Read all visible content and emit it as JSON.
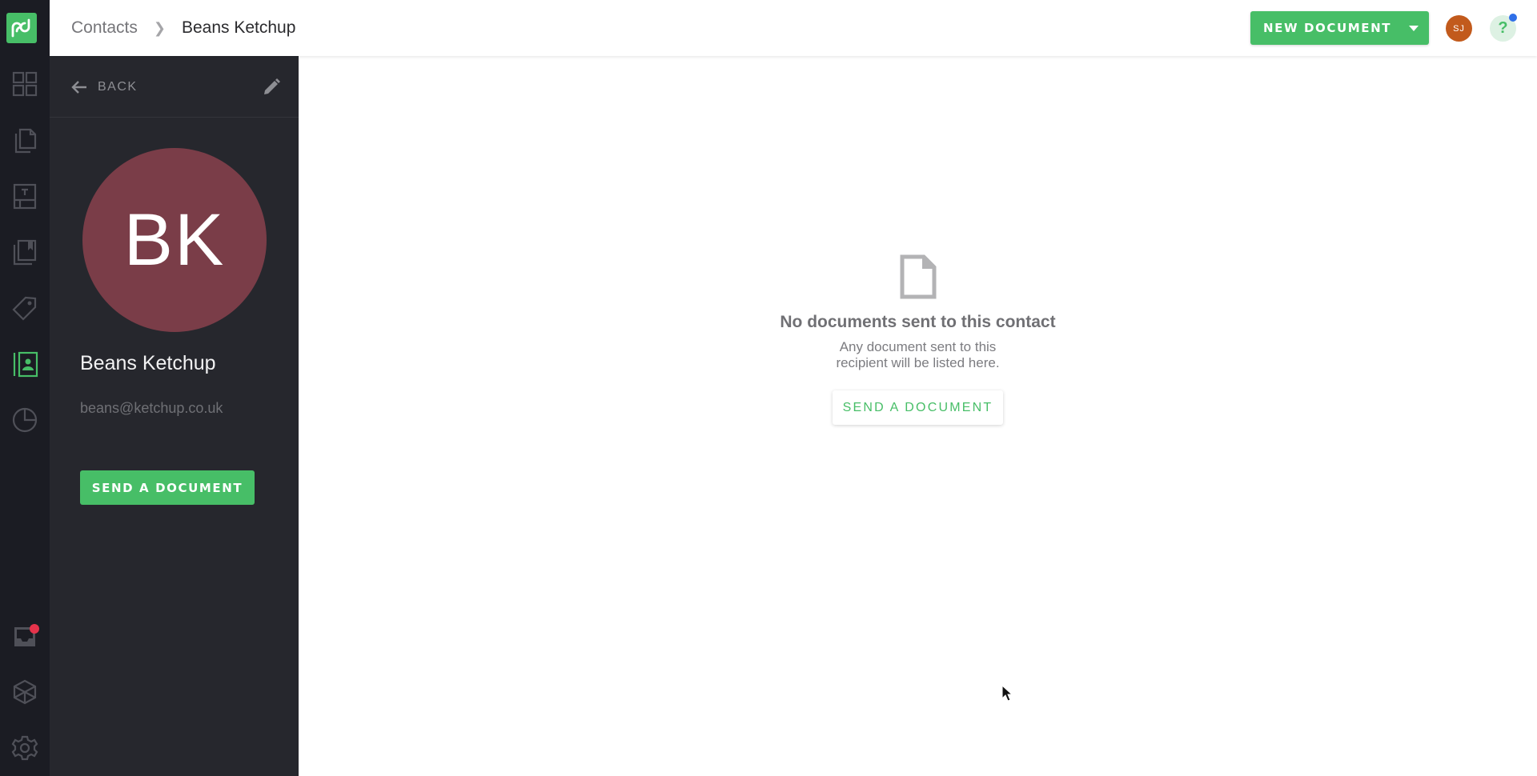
{
  "nav": {
    "logo": "pandadoc-logo",
    "items": [
      {
        "name": "dashboard",
        "icon": "grid-icon",
        "active": false
      },
      {
        "name": "documents",
        "icon": "documents-icon",
        "active": false
      },
      {
        "name": "templates",
        "icon": "template-icon",
        "active": false
      },
      {
        "name": "content-library",
        "icon": "library-icon",
        "active": false
      },
      {
        "name": "catalog",
        "icon": "tag-icon",
        "active": false
      },
      {
        "name": "contacts",
        "icon": "contact-card-icon",
        "active": true
      },
      {
        "name": "reports",
        "icon": "pie-chart-icon",
        "active": false
      }
    ],
    "bottom_items": [
      {
        "name": "inbox",
        "icon": "inbox-icon",
        "has_notification": true
      },
      {
        "name": "integrations",
        "icon": "cube-icon"
      },
      {
        "name": "settings",
        "icon": "gear-icon"
      }
    ],
    "notification_color": "#e5334b"
  },
  "header": {
    "breadcrumb_parent": "Contacts",
    "breadcrumb_separator": "❯",
    "breadcrumb_current": "Beans Ketchup",
    "new_document_label": "NEW DOCUMENT",
    "user_initials": "SJ",
    "help_label": "?"
  },
  "contact": {
    "back_label": "BACK",
    "initials": "BK",
    "name": "Beans Ketchup",
    "email": "beans@ketchup.co.uk",
    "send_button_label": "SEND A DOCUMENT",
    "avatar_color": "#7a3d48"
  },
  "empty_state": {
    "title": "No documents sent to this contact",
    "subtitle_line1": "Any document sent to this",
    "subtitle_line2": "recipient will be listed here.",
    "button_label": "SEND A DOCUMENT"
  },
  "colors": {
    "brand_green": "#47be67",
    "nav_bg": "#1b1c23",
    "panel_bg": "#26272d",
    "user_avatar": "#c25a1c",
    "help_dot": "#2f6fe8"
  }
}
